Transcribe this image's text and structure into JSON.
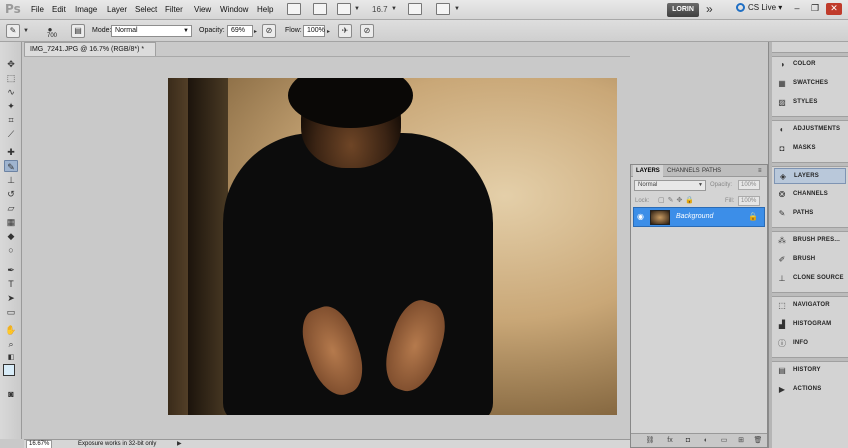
{
  "app": {
    "logo": "Ps"
  },
  "menu": [
    "File",
    "Edit",
    "Image",
    "Layer",
    "Select",
    "Filter",
    "View",
    "Window",
    "Help"
  ],
  "menubar": {
    "zoom": "16.7",
    "user": "LORIN",
    "cs_live": "CS Live"
  },
  "options": {
    "brush_size": "700",
    "mode_label": "Mode:",
    "mode_value": "Normal",
    "opacity_label": "Opacity:",
    "opacity_value": "69%",
    "flow_label": "Flow:",
    "flow_value": "100%"
  },
  "document": {
    "tab_title": "IMG_7241.JPG @ 16.7% (RGB/8*) *"
  },
  "colors": {
    "foreground": "#d8ecf8",
    "background": "#ffffff",
    "layer_selected": "#3c8ee8"
  },
  "layers_panel": {
    "tabs": [
      "LAYERS",
      "CHANNELS",
      "PATHS"
    ],
    "blend_mode": "Normal",
    "opacity_label": "Opacity:",
    "opacity_value": "100%",
    "lock_label": "Lock:",
    "fill_label": "Fill:",
    "fill_value": "100%",
    "layers": [
      {
        "name": "Background",
        "visible": true,
        "locked": true
      }
    ]
  },
  "dock": {
    "groups": [
      [
        {
          "icon": "color-icon",
          "label": "COLOR"
        },
        {
          "icon": "swatches-icon",
          "label": "SWATCHES"
        },
        {
          "icon": "styles-icon",
          "label": "STYLES"
        }
      ],
      [
        {
          "icon": "adjustments-icon",
          "label": "ADJUSTMENTS"
        },
        {
          "icon": "masks-icon",
          "label": "MASKS"
        }
      ],
      [
        {
          "icon": "layers-icon",
          "label": "LAYERS"
        },
        {
          "icon": "channels-icon",
          "label": "CHANNELS"
        },
        {
          "icon": "paths-icon",
          "label": "PATHS"
        }
      ],
      [
        {
          "icon": "brush-presets-icon",
          "label": "BRUSH PRES..."
        },
        {
          "icon": "brush-icon",
          "label": "BRUSH"
        },
        {
          "icon": "clone-source-icon",
          "label": "CLONE SOURCE"
        }
      ],
      [
        {
          "icon": "navigator-icon",
          "label": "NAVIGATOR"
        },
        {
          "icon": "histogram-icon",
          "label": "HISTOGRAM"
        },
        {
          "icon": "info-icon",
          "label": "INFO"
        }
      ],
      [
        {
          "icon": "history-icon",
          "label": "HISTORY"
        },
        {
          "icon": "actions-icon",
          "label": "ACTIONS"
        }
      ]
    ]
  },
  "status": {
    "zoom": "16.67%",
    "message": "Exposure works in 32-bit only"
  }
}
